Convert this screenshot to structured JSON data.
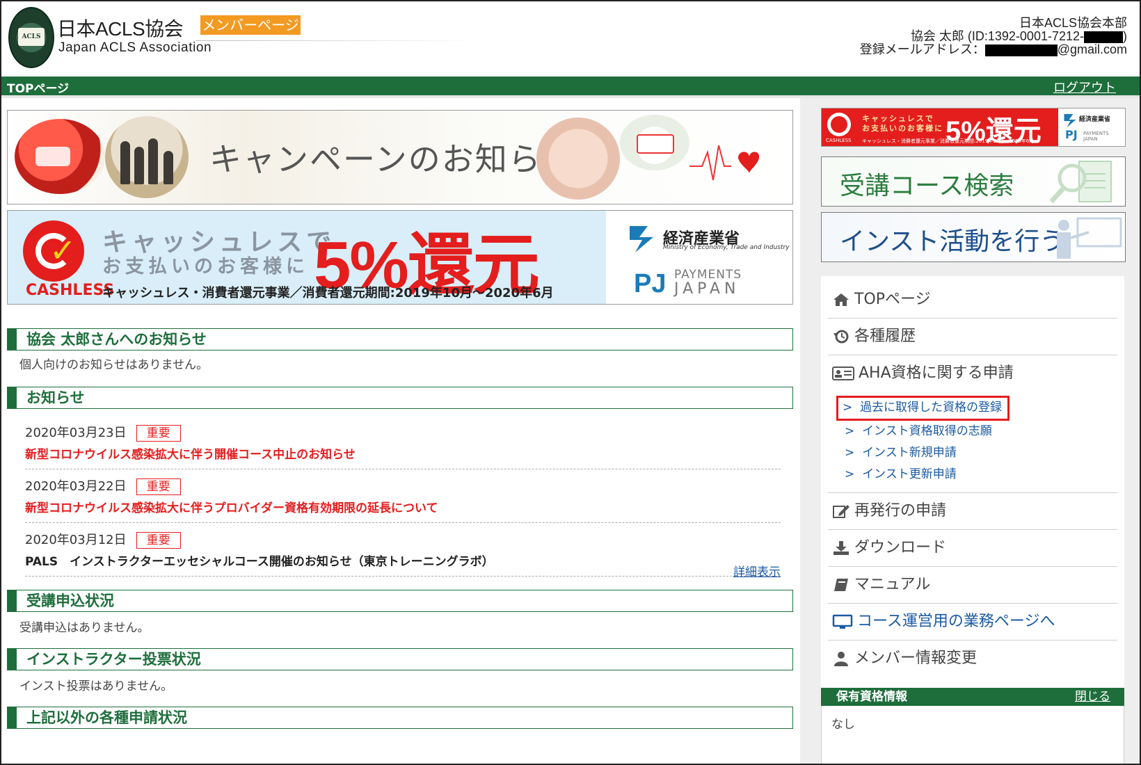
{
  "header": {
    "site_title": "日本ACLS協会",
    "site_subtitle": "Japan ACLS Association",
    "member_tag": "メンバーページ",
    "seal_text": "ACLS",
    "org": "日本ACLS協会本部",
    "user_line": "協会 太郎 (ID:1392-0001-7212-",
    "user_line_end": ")",
    "email_label": "登録メールアドレス：",
    "email_domain": "@gmail.com"
  },
  "topbar": {
    "page_title": "TOPページ",
    "logout": "ログアウト"
  },
  "banners": {
    "campaign": "キャンペーンのお知らせ",
    "cashless": {
      "brand": "CASHLESS",
      "line1": "キャッシュレスで",
      "line2": "お支払いのお客様に",
      "big": "5%還元",
      "footer": "キャッシュレス・消費者還元事業／消費者還元期間:2019年10月～2020年6月",
      "meti": "経済産業省",
      "meti_en": "Ministry of Economy, Trade and Industry",
      "pj_mark": "PJ",
      "pj_1": "PAYMENTS",
      "pj_2": "JAPAN"
    }
  },
  "sections": {
    "personal": {
      "title": "協会 太郎さんへのお知らせ",
      "body": "個人向けのお知らせはありません。"
    },
    "news": {
      "title": "お知らせ",
      "items": [
        {
          "date": "2020年03月23日",
          "badge": "重要",
          "title": "新型コロナウイルス感染拡大に伴う開催コース中止のお知らせ"
        },
        {
          "date": "2020年03月22日",
          "badge": "重要",
          "title": "新型コロナウイルス感染拡大に伴うプロバイダー資格有効期限の延長について"
        },
        {
          "date": "2020年03月12日",
          "badge": "重要",
          "title": "PALS　インストラクターエッセシャルコース開催のお知らせ（東京トレーニングラボ）"
        }
      ],
      "more": "詳細表示"
    },
    "apply": {
      "title": "受講申込状況",
      "body": "受講申込はありません。"
    },
    "vote": {
      "title": "インストラクター投票状況",
      "body": "インスト投票はありません。"
    },
    "other": {
      "title": "上記以外の各種申請状況"
    }
  },
  "sidebar": {
    "cash_banner": {
      "line1": "キャッシュレスで",
      "line2": "お支払いのお客様に",
      "big": "5%還元",
      "foot": "キャッシュレス・消費者還元事業／消費者還元期間:2019年10月～2020年6月",
      "brand": "CASHLESS",
      "meti": "経済産業省",
      "pj": "PJ",
      "pj_text": "PAYMENTS JAPAN"
    },
    "search_banner": "受講コース検索",
    "inst_banner": "インスト活動を行う",
    "menu": {
      "top": "TOPページ",
      "history": "各種履歴",
      "aha": "AHA資格に関する申請",
      "aha_sub": [
        "過去に取得した資格の登録",
        "インスト資格取得の志願",
        "インスト新規申請",
        "インスト更新申請"
      ],
      "sub_arrow": ">",
      "reissue": "再発行の申請",
      "download": "ダウンロード",
      "manual": "マニュアル",
      "ops": "コース運営用の業務ページへ",
      "member": "メンバー情報変更"
    },
    "held": {
      "title": "保有資格情報",
      "close": "閉じる",
      "body": "なし"
    }
  }
}
